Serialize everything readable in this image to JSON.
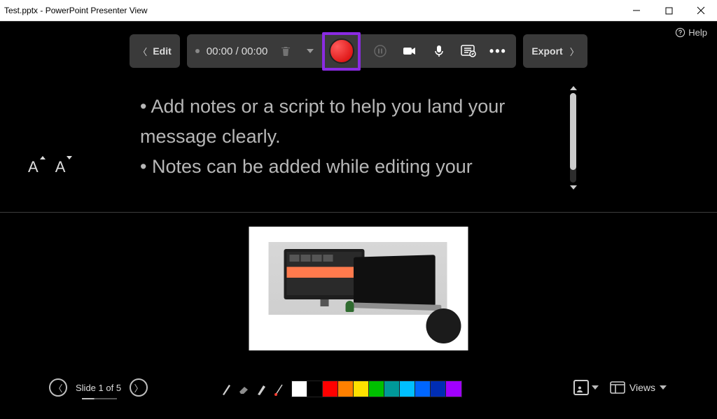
{
  "window": {
    "title": "Test.pptx - PowerPoint Presenter View"
  },
  "help_label": "Help",
  "toolbar": {
    "edit_label": "Edit",
    "timecode": "00:00 / 00:00",
    "export_label": "Export"
  },
  "notes": {
    "line1": "• Add notes or a script to help you land your message clearly.",
    "line2": "• Notes can be added while editing your"
  },
  "nav": {
    "position": "Slide 1 of 5"
  },
  "palette": [
    "#ffffff",
    "#000000",
    "#ff0000",
    "#ff8000",
    "#ffe000",
    "#00c000",
    "#009999",
    "#00bfff",
    "#0066ff",
    "#002db3",
    "#a000ff"
  ],
  "views_label": "Views"
}
